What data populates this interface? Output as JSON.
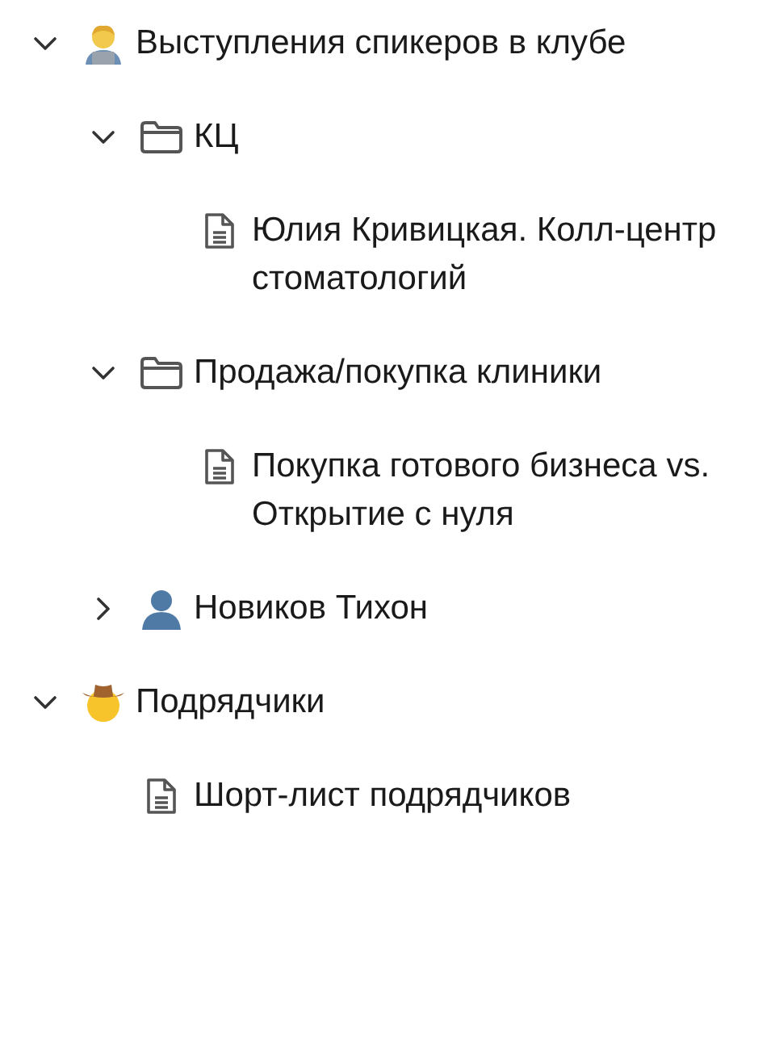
{
  "tree": [
    {
      "label": "Выступления спикеров в клубе",
      "kind": "person-laptop",
      "expanded": true,
      "children": [
        {
          "label": "КЦ",
          "kind": "folder",
          "expanded": true,
          "children": [
            {
              "label": "Юлия Кривицкая. Колл-центр стоматологий",
              "kind": "document"
            }
          ]
        },
        {
          "label": "Продажа/покупка клиники",
          "kind": "folder",
          "expanded": true,
          "children": [
            {
              "label": "Покупка готового бизнеса vs. Открытие с нуля",
              "kind": "document"
            }
          ]
        },
        {
          "label": "Новиков Тихон",
          "kind": "person",
          "expanded": false
        }
      ]
    },
    {
      "label": "Подрядчики",
      "kind": "cowboy",
      "expanded": true,
      "children": [
        {
          "label": "Шорт-лист подрядчиков",
          "kind": "document"
        }
      ]
    }
  ]
}
